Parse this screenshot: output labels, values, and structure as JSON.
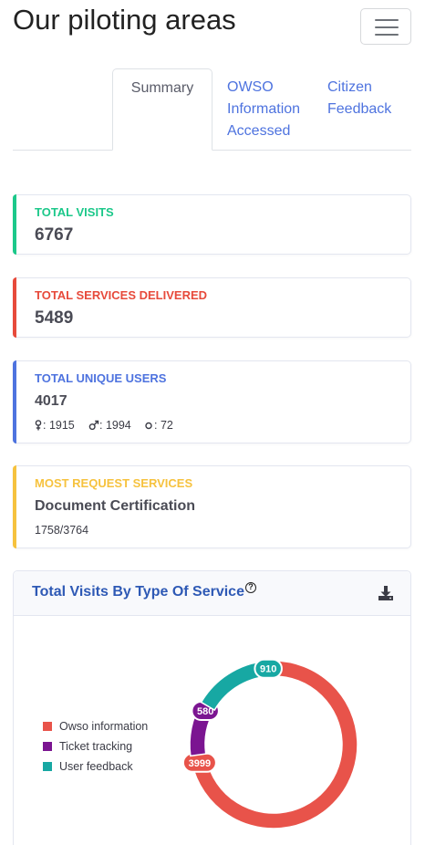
{
  "header": {
    "title": "Our piloting areas"
  },
  "tabs": [
    {
      "label": "Summary",
      "active": true
    },
    {
      "label_lines": [
        "OWSO",
        "Information",
        "Accessed"
      ]
    },
    {
      "label_lines": [
        "Citizen",
        "Feedback"
      ]
    }
  ],
  "stats": {
    "total_visits": {
      "label": "TOTAL VISITS",
      "value": "6767",
      "color": "#1cc88a"
    },
    "total_services": {
      "label": "TOTAL SERVICES DELIVERED",
      "value": "5489",
      "color": "#e74a3b"
    },
    "unique_users": {
      "label": "TOTAL UNIQUE USERS",
      "value": "4017",
      "color": "#4e73df",
      "female": ": 1915",
      "male": ": 1994",
      "other": ": 72"
    },
    "most_requested": {
      "label": "MOST REQUEST SERVICES",
      "value": "Document Certification",
      "ratio": "1758/3764",
      "color": "#f6c23e"
    }
  },
  "chart_card": {
    "title": "Total Visits By Type Of Service",
    "help_symbol": "?"
  },
  "chart_data": {
    "type": "pie",
    "subtype": "donut",
    "categories": [
      "Owso information",
      "Ticket tracking",
      "User feedback"
    ],
    "values": [
      3999,
      580,
      910
    ],
    "colors": [
      "#e8534a",
      "#7b1591",
      "#17a8a3"
    ],
    "legend_position": "left"
  }
}
